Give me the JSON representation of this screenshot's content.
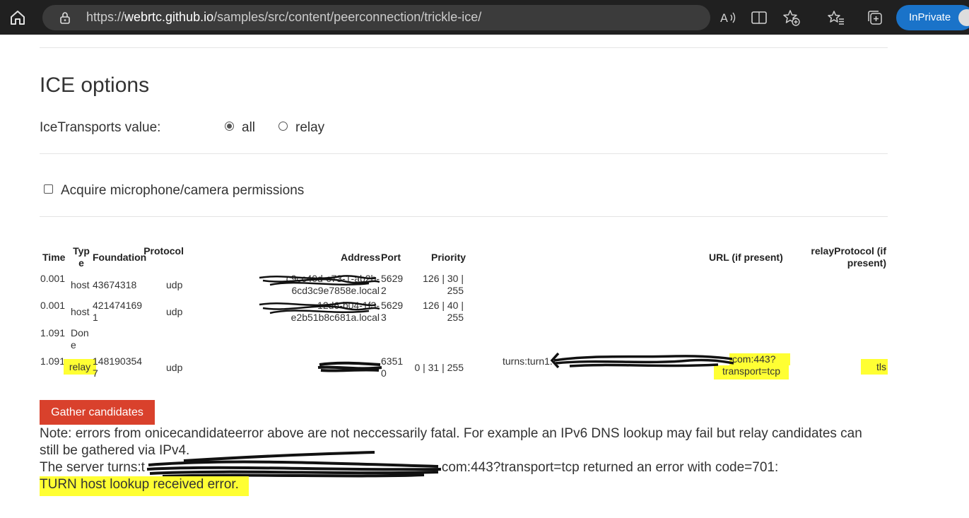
{
  "browser": {
    "url_prefix": "https://",
    "url_host": "webrtc.github.io",
    "url_path": "/samples/src/content/peerconnection/trickle-ice/",
    "inprivate_label": "InPrivate"
  },
  "ice_options": {
    "heading": "ICE options",
    "transports_label": "IceTransports value:",
    "option_all": "all",
    "option_relay": "relay",
    "selected": "all",
    "permissions_label": "Acquire microphone/camera permissions",
    "permissions_checked": false
  },
  "table": {
    "headers": {
      "time": "Time",
      "type": "Type",
      "foundation": "Foundation",
      "protocol": "Protocol",
      "address": "Address",
      "port": "Port",
      "priority": "Priority",
      "url": "URL (if present)",
      "relay_protocol": "relayProtocol (if present)"
    },
    "rows": [
      {
        "time": "0.001",
        "type": "host",
        "foundation": "43674318",
        "protocol": "udp",
        "address_line1": "c9cc40d-c73-1-ab2b-",
        "address_line2": "6cd3c9e7858e.local",
        "port": "56292",
        "priority": "126 | 30 | 255",
        "url": "",
        "relay_protocol": ""
      },
      {
        "time": "0.001",
        "type": "host",
        "foundation": "4214741691",
        "protocol": "udp",
        "address_line1": "12d6-b04-1f3-",
        "address_line2": "e2b51b8c681a.local",
        "port": "56293",
        "priority": "126 | 40 | 255",
        "url": "",
        "relay_protocol": ""
      },
      {
        "time": "1.091",
        "type": "Done",
        "foundation": "",
        "protocol": "",
        "address_line1": "",
        "address_line2": "",
        "port": "",
        "priority": "",
        "url": "",
        "relay_protocol": ""
      },
      {
        "time": "1.091",
        "type": "relay",
        "foundation": "1481903547",
        "protocol": "udp",
        "address_line1": "",
        "address_line2": "",
        "port": "63510",
        "priority": "0 | 31 | 255",
        "url_start": "turns:turn1.",
        "url_end": "com:443?",
        "url_line2": "transport=tcp",
        "relay_protocol": "tls"
      }
    ]
  },
  "gather_button_label": "Gather candidates",
  "note": {
    "line1": "Note: errors from onicecandidateerror above are not neccessarily fatal. For example an IPv6 DNS lookup may fail but relay candidates can",
    "line2": "still be gathered via IPv4.",
    "line3_start": "The server turns:t",
    "line3_end": "com:443?transport=tcp returned an error with code=701:",
    "line4": "TURN host lookup received error."
  }
}
